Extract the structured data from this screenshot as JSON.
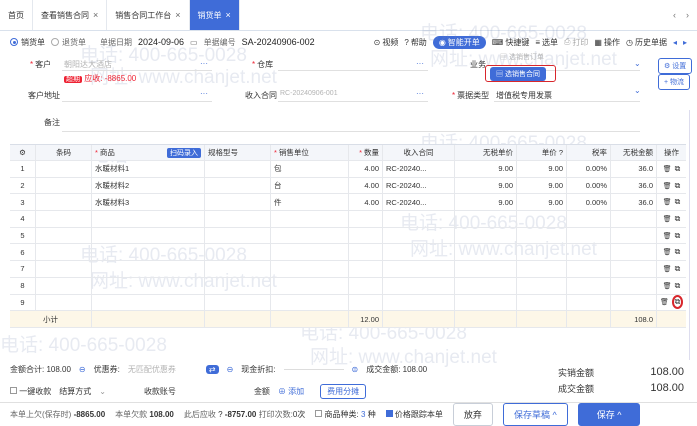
{
  "tabs": [
    {
      "label": "首页",
      "close": false
    },
    {
      "label": "查看销售合同",
      "close": true
    },
    {
      "label": "销售合同工作台",
      "close": true
    },
    {
      "label": "销货单",
      "close": true,
      "active": true
    }
  ],
  "doc": {
    "type_sale": "销货单",
    "type_return": "退货单",
    "date_label": "单据日期",
    "date": "2024-09-06",
    "no_label": "单据编号",
    "no": "SA-20240906-002"
  },
  "toolbar": {
    "video": "视频",
    "help": "帮助",
    "smart": "智能开单",
    "shortcut": "快捷键",
    "select": "选单",
    "print": "打印",
    "ops": "操作",
    "history": "历史单据"
  },
  "form": {
    "customer_label": "客户",
    "customer_ph": "朝阳达大酒店",
    "overdue_tag": "超期",
    "receivable": "应收: -8865.00",
    "warehouse_label": "仓库",
    "biz_label": "业务",
    "select_order": "选销售订单",
    "select_contract": "选销售合同",
    "settings": "设置",
    "logistics": "物流",
    "addr_label": "客户地址",
    "contract_label": "收入合同",
    "contract_ph": "RC-20240906-001",
    "invoice_label": "票据类型",
    "invoice": "增值税专用发票",
    "remark_label": "备注"
  },
  "grid": {
    "headers": [
      "",
      "条码",
      "商品",
      "规格型号",
      "销售单位",
      "数量",
      "收入合同",
      "无税单价",
      "单价",
      "税率",
      "无税金额",
      "操作"
    ],
    "scan": "扫码录入",
    "rows": [
      [
        "1",
        "",
        "水暖材料1",
        "",
        "包",
        "4.00",
        "RC-20240...",
        "9.00",
        "9.00",
        "0.00%",
        "36.0"
      ],
      [
        "2",
        "",
        "水暖材料2",
        "",
        "台",
        "4.00",
        "RC-20240...",
        "9.00",
        "9.00",
        "0.00%",
        "36.0"
      ],
      [
        "3",
        "",
        "水暖材料3",
        "",
        "件",
        "4.00",
        "RC-20240...",
        "9.00",
        "9.00",
        "0.00%",
        "36.0"
      ],
      [
        "4",
        "",
        "",
        "",
        "",
        "",
        "",
        "",
        "",
        "",
        ""
      ],
      [
        "5",
        "",
        "",
        "",
        "",
        "",
        "",
        "",
        "",
        "",
        ""
      ],
      [
        "6",
        "",
        "",
        "",
        "",
        "",
        "",
        "",
        "",
        "",
        ""
      ],
      [
        "7",
        "",
        "",
        "",
        "",
        "",
        "",
        "",
        "",
        "",
        ""
      ],
      [
        "8",
        "",
        "",
        "",
        "",
        "",
        "",
        "",
        "",
        "",
        ""
      ],
      [
        "9",
        "",
        "",
        "",
        "",
        "",
        "",
        "",
        "",
        "",
        ""
      ]
    ],
    "subtotal": "小计",
    "sub_qty": "12.00",
    "sub_amt": "108.0"
  },
  "bottom": {
    "total_label": "金额合计: 108.00",
    "discount_label": "优惠券:",
    "discount_ph": "无匹配优惠券",
    "cash_label": "现金折扣:",
    "deal_label": "成交金额: 108.00",
    "onekey": "一键收款",
    "settle_label": "结算方式",
    "account_label": "收款账号",
    "amount_label": "金额",
    "add": "添加",
    "fee": "费用分摊"
  },
  "summary": {
    "actual_label": "实销金额",
    "actual": "108.00",
    "deal_label": "成交金额",
    "deal": "108.00"
  },
  "footer": {
    "owe_label": "本单上欠(保存时)",
    "owe": "-8865.00",
    "this_owe_label": "本单欠款",
    "this_owe": "108.00",
    "after_label": "此后应收",
    "after": "-8757.00",
    "print_label": "打印次数:",
    "print_count": "0次",
    "kinds_label": "商品种类:",
    "kinds": "3",
    "kinds_unit": "种",
    "track": "价格跟踪本单",
    "abandon": "放弃",
    "save_draft": "保存草稿",
    "save": "保存"
  },
  "watermark": {
    "phone": "电话: 400-665-0028",
    "site": "网址: www.chanjet.net"
  }
}
